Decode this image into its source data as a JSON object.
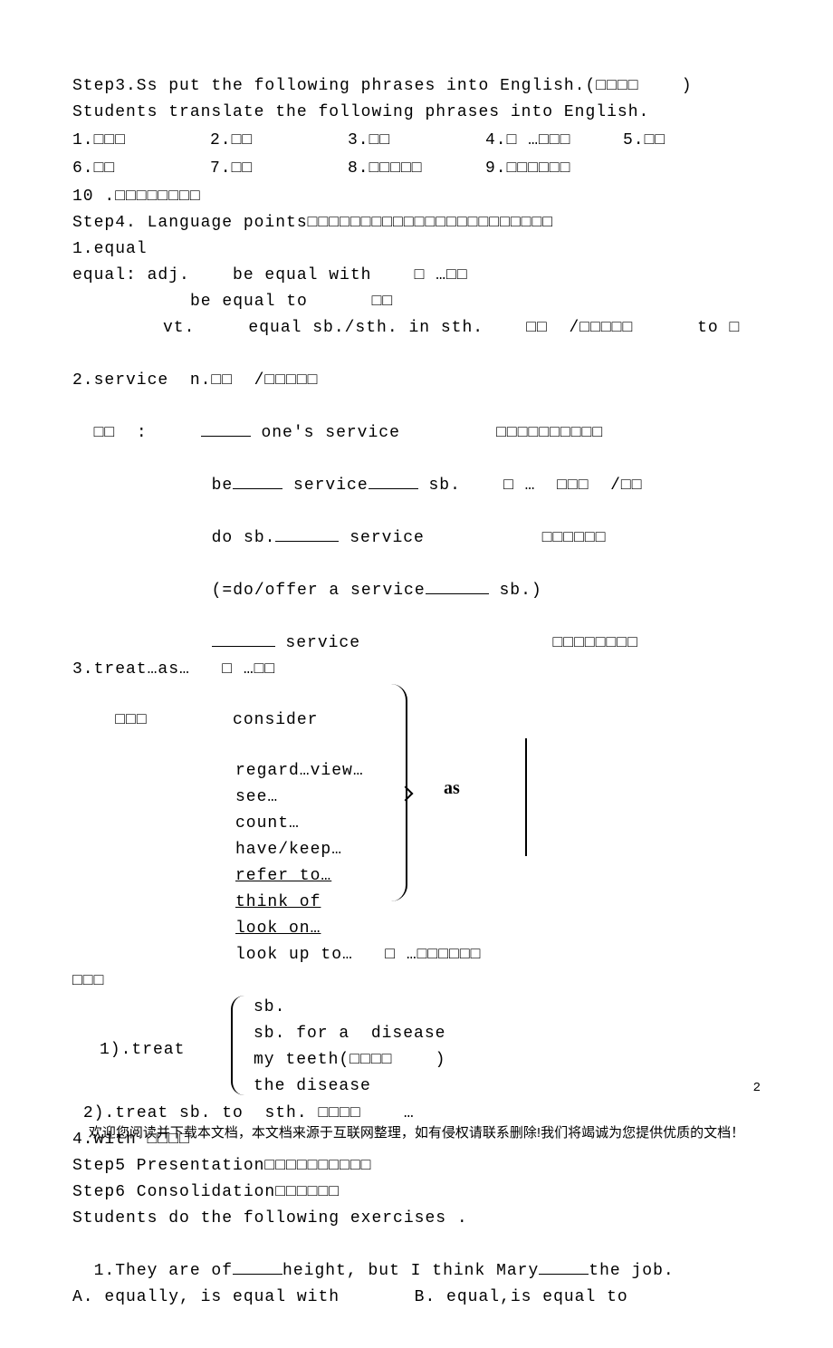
{
  "step3": {
    "title_a": "Step3.Ss put the following phrases into English.(□□□□    )",
    "title_b": "Students translate the following phrases into English.",
    "row1": [
      "1.□□□",
      "2.□□",
      "3.□□",
      "4.□ …□□□",
      "5.□□"
    ],
    "row2": [
      "6.□□",
      "7.□□",
      "8.□□□□□",
      "9.□□□□□□"
    ],
    "row3": "10 .□□□□□□□□"
  },
  "step4": {
    "title": "Step4. Language points□□□□□□□□□□□□□□□□□□□□□□□",
    "p1": {
      "l1": "1.equal",
      "l2": "equal: adj.    be equal with    □ …□□",
      "l3": "be equal to      □□",
      "l4": "vt.     equal sb./sth. in sth.    □□  /□□□□□      to □"
    },
    "p2": {
      "l1": "2.service  n.□□  /□□□□□",
      "l2a": "□□  :",
      "l2b": "one's service",
      "l2c": "□□□□□□□□□□",
      "l3a": "be",
      "l3b": "service",
      "l3c": "sb.    □ …  □□□  /□□",
      "l4a": "do sb.",
      "l4b": "service",
      "l4c": "□□□□□□",
      "l5a": "(=do/offer a service",
      "l5b": "sb.)",
      "l6a": "service",
      "l6b": "□□□□□□□□"
    },
    "p3": {
      "l1": "3.treat…as…   □ …□□",
      "ext_label": "□□□",
      "items": [
        "consider",
        "regard…view…",
        "see…",
        "count…",
        "have/keep…",
        "refer to…",
        "think of",
        "look on…",
        "look up to…   □ …□□□□□□"
      ],
      "as": "as"
    },
    "treat_block": {
      "label": "1).treat",
      "r1": "sb.",
      "r2": "sb. for a  disease",
      "r3": "my teeth(□□□□    )",
      "r4": "the disease",
      "l2": "2).treat sb. to  sth. □□□□    …"
    },
    "p4": "4.with □□□□"
  },
  "step5": "Step5 Presentation□□□□□□□□□□",
  "step6": "Step6 Consolidation□□□□□□",
  "exercise": {
    "intro": "Students do the following exercises .",
    "q1": {
      "pre": "1.They are of",
      "mid": "height, but I think Mary",
      "post": "the job."
    },
    "opts": "A. equally, is equal with       B. equal,is equal to"
  },
  "page": "2",
  "footer": "欢迎您阅读并下载本文档，本文档来源于互联网整理，如有侵权请联系删除!我们将竭诚为您提供优质的文档！"
}
